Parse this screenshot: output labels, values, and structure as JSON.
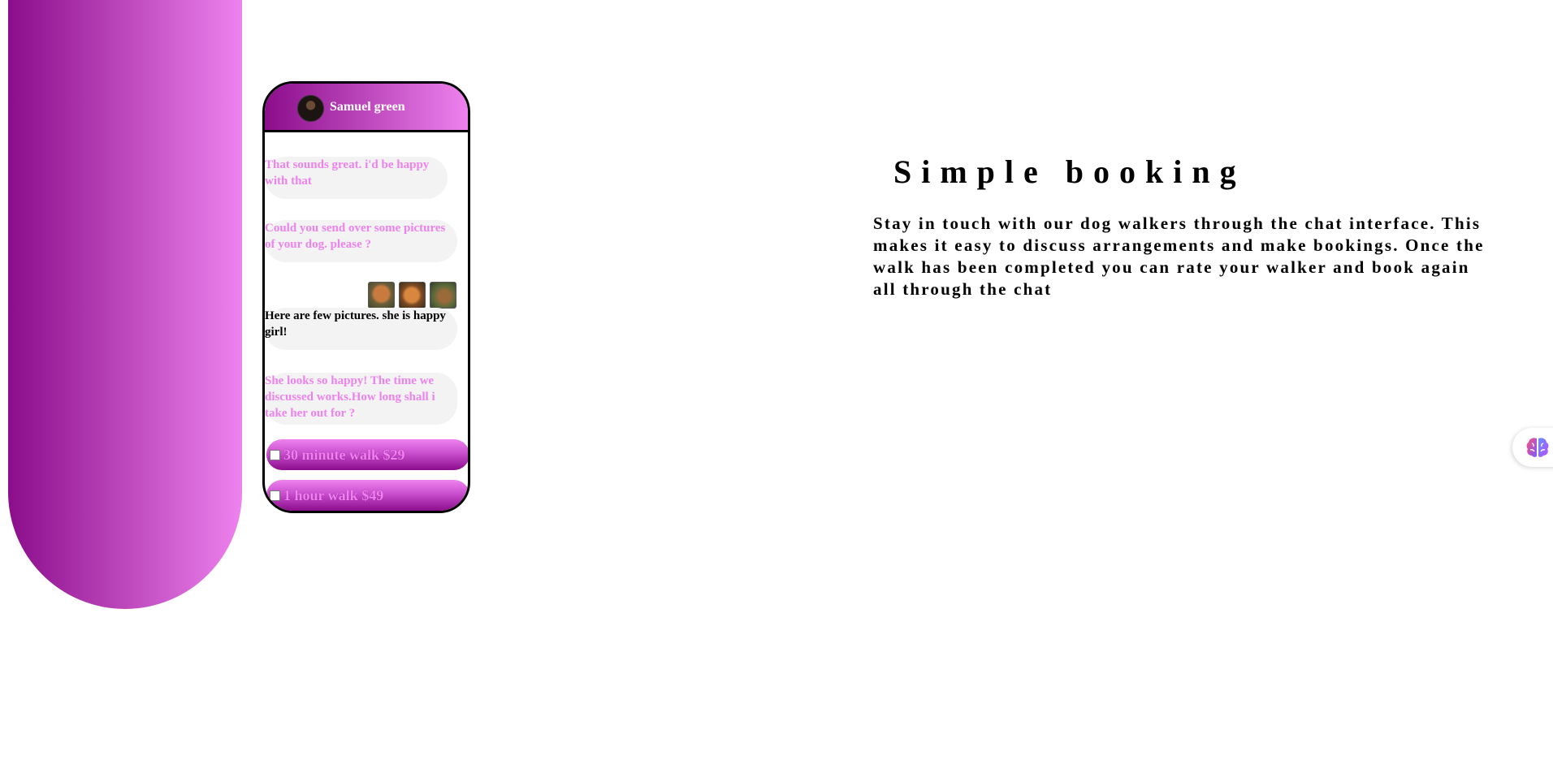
{
  "chat": {
    "contact_name": "Samuel green",
    "messages": [
      {
        "text": "That sounds great. i'd be happy with that",
        "style": "pink"
      },
      {
        "text": "Could you send over some pictures of your dog. please ?",
        "style": "pink"
      },
      {
        "text": "Here are few pictures. she is happy girl!",
        "style": "dark",
        "attachments": 3
      },
      {
        "text": "She looks so happy! The time we discussed works.How long shall i take her out for ?",
        "style": "pink"
      }
    ],
    "options": [
      {
        "label": "30 minute walk $29",
        "checked": false
      },
      {
        "label": "1 hour walk $49",
        "checked": false
      }
    ]
  },
  "section": {
    "title": "Simple booking",
    "description": "Stay in touch with our dog walkers through the chat interface. This makes it easy to discuss arrangements and make bookings. Once the walk has been completed you can rate your walker and book again all through the chat"
  },
  "colors": {
    "gradient_start": "#8b0d8b",
    "gradient_end": "#ee82ee",
    "bubble_bg": "#f3f3f3"
  },
  "icons": {
    "floating_button": "brain-icon"
  }
}
